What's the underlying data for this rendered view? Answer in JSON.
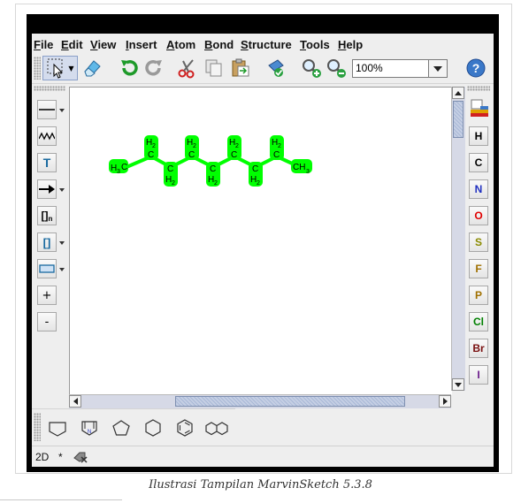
{
  "menu": {
    "items": [
      {
        "first": "F",
        "rest": "ile"
      },
      {
        "first": "E",
        "rest": "dit"
      },
      {
        "first": "V",
        "rest": "iew"
      },
      {
        "first": "I",
        "rest": "nsert"
      },
      {
        "first": "A",
        "rest": "tom"
      },
      {
        "first": "B",
        "rest": "ond"
      },
      {
        "first": "S",
        "rest": "tructure"
      },
      {
        "first": "T",
        "rest": "ools"
      },
      {
        "first": "H",
        "rest": "elp"
      }
    ]
  },
  "toolbar": {
    "zoom_value": "100%",
    "icons": [
      "select-icon",
      "eraser-icon",
      "undo-icon",
      "redo-icon",
      "cut-icon",
      "copy-icon",
      "paste-icon",
      "clean-icon",
      "zoom-in-icon",
      "zoom-out-icon",
      "help-icon"
    ]
  },
  "left_tools": {
    "text_tool": "T",
    "bracket_tool": "[]",
    "bracket_sub": "n",
    "plus": "+",
    "minus": "-"
  },
  "atoms": [
    {
      "symbol": "H",
      "color": "#000000"
    },
    {
      "symbol": "C",
      "color": "#000000"
    },
    {
      "symbol": "N",
      "color": "#2030c0"
    },
    {
      "symbol": "O",
      "color": "#e00000"
    },
    {
      "symbol": "S",
      "color": "#8a8a00"
    },
    {
      "symbol": "F",
      "color": "#a07000"
    },
    {
      "symbol": "P",
      "color": "#a07000"
    },
    {
      "symbol": "Cl",
      "color": "#008000"
    },
    {
      "symbol": "Br",
      "color": "#7a1010"
    },
    {
      "symbol": "I",
      "color": "#6a1a8a"
    }
  ],
  "molecule": {
    "highlight_color": "#00ff00",
    "ends": {
      "h3": "H",
      "h3_sub": "3",
      "c": "C",
      "ch": "CH",
      "ch_sub": "3"
    },
    "nodes": [
      {
        "h": "H",
        "sub": "2",
        "c": "C"
      },
      {
        "h": "H",
        "sub": "2",
        "c": "C"
      },
      {
        "h": "H",
        "sub": "2",
        "c": "C"
      },
      {
        "h": "H",
        "sub": "2",
        "c": "C"
      },
      {
        "h": "H",
        "sub": "2",
        "c": "C"
      },
      {
        "h": "H",
        "sub": "2",
        "c": "C"
      },
      {
        "h": "H",
        "sub": "2",
        "c": "C"
      },
      {
        "h": "H",
        "sub": "2",
        "c": "C"
      }
    ]
  },
  "status": {
    "mode": "2D",
    "modified": "*"
  },
  "caption": "Ilustrasi Tampilan MarvinSketch 5.3.8"
}
